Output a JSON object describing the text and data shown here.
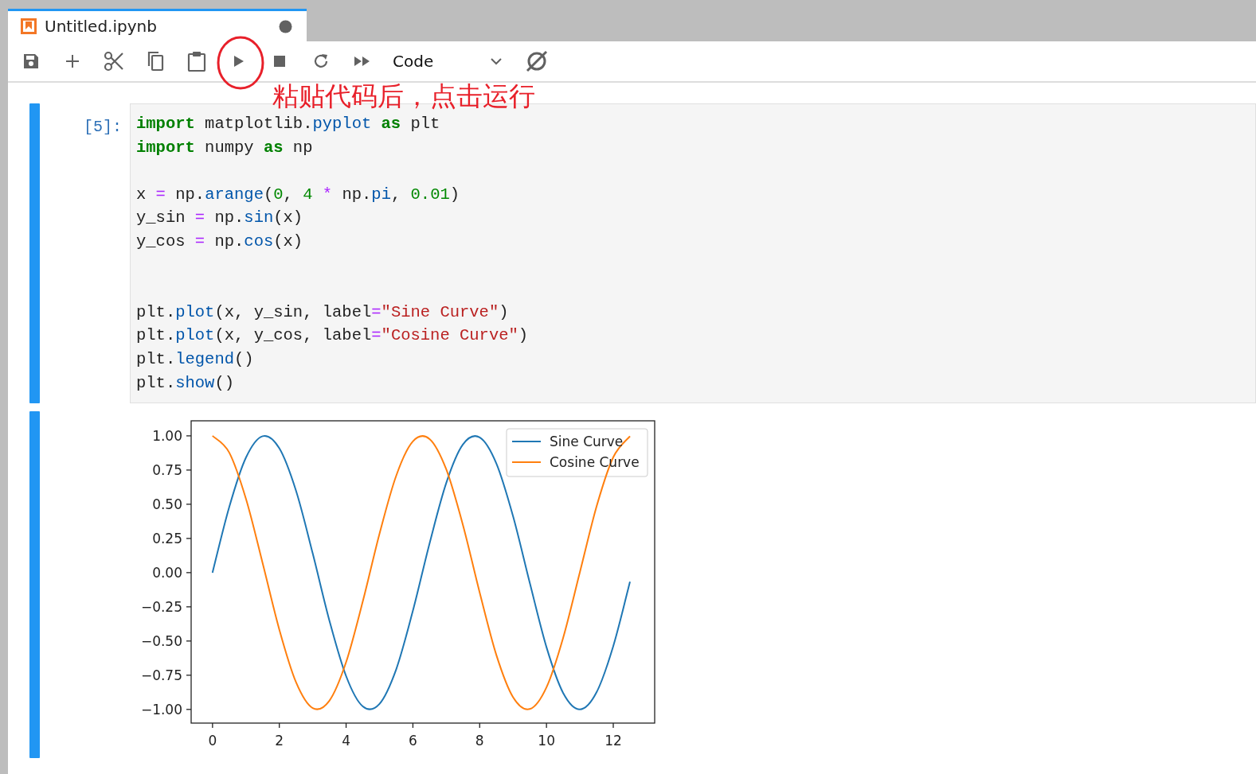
{
  "tab": {
    "title": "Untitled.ipynb"
  },
  "toolbar": {
    "cell_type": "Code"
  },
  "annotation": {
    "text": "粘贴代码后，点击运行"
  },
  "cell": {
    "prompt": "[5]:",
    "lines": [
      {
        "kind": "code",
        "tokens": [
          {
            "kind": "kw",
            "text": "import"
          },
          {
            "kind": "plain",
            "text": " matplotlib."
          },
          {
            "kind": "attr",
            "text": "pyplot"
          },
          {
            "kind": "kw",
            "text": " as"
          },
          {
            "kind": "plain",
            "text": " plt"
          }
        ]
      },
      {
        "kind": "code",
        "tokens": [
          {
            "kind": "kw",
            "text": "import"
          },
          {
            "kind": "plain",
            "text": " numpy "
          },
          {
            "kind": "kw",
            "text": "as"
          },
          {
            "kind": "plain",
            "text": " np"
          }
        ]
      },
      {
        "kind": "blank"
      },
      {
        "kind": "code",
        "tokens": [
          {
            "kind": "plain",
            "text": "x "
          },
          {
            "kind": "op",
            "text": "="
          },
          {
            "kind": "plain",
            "text": " np."
          },
          {
            "kind": "attr",
            "text": "arange"
          },
          {
            "kind": "plain",
            "text": "("
          },
          {
            "kind": "num",
            "text": "0"
          },
          {
            "kind": "plain",
            "text": ", "
          },
          {
            "kind": "num",
            "text": "4"
          },
          {
            "kind": "op",
            "text": " *"
          },
          {
            "kind": "plain",
            "text": " np."
          },
          {
            "kind": "attr",
            "text": "pi"
          },
          {
            "kind": "plain",
            "text": ", "
          },
          {
            "kind": "num",
            "text": "0.01"
          },
          {
            "kind": "plain",
            "text": ")"
          }
        ]
      },
      {
        "kind": "code",
        "tokens": [
          {
            "kind": "plain",
            "text": "y_sin "
          },
          {
            "kind": "op",
            "text": "="
          },
          {
            "kind": "plain",
            "text": " np."
          },
          {
            "kind": "attr",
            "text": "sin"
          },
          {
            "kind": "plain",
            "text": "(x)"
          }
        ]
      },
      {
        "kind": "code",
        "tokens": [
          {
            "kind": "plain",
            "text": "y_cos "
          },
          {
            "kind": "op",
            "text": "="
          },
          {
            "kind": "plain",
            "text": " np."
          },
          {
            "kind": "attr",
            "text": "cos"
          },
          {
            "kind": "plain",
            "text": "(x)"
          }
        ]
      },
      {
        "kind": "blank"
      },
      {
        "kind": "blank"
      },
      {
        "kind": "code",
        "tokens": [
          {
            "kind": "plain",
            "text": "plt."
          },
          {
            "kind": "attr",
            "text": "plot"
          },
          {
            "kind": "plain",
            "text": "(x, y_sin, label"
          },
          {
            "kind": "op",
            "text": "="
          },
          {
            "kind": "str",
            "text": "\"Sine Curve\""
          },
          {
            "kind": "plain",
            "text": ")"
          }
        ]
      },
      {
        "kind": "code",
        "tokens": [
          {
            "kind": "plain",
            "text": "plt."
          },
          {
            "kind": "attr",
            "text": "plot"
          },
          {
            "kind": "plain",
            "text": "(x, y_cos, label"
          },
          {
            "kind": "op",
            "text": "="
          },
          {
            "kind": "str",
            "text": "\"Cosine Curve\""
          },
          {
            "kind": "plain",
            "text": ")"
          }
        ]
      },
      {
        "kind": "code",
        "tokens": [
          {
            "kind": "plain",
            "text": "plt."
          },
          {
            "kind": "attr",
            "text": "legend"
          },
          {
            "kind": "plain",
            "text": "()"
          }
        ]
      },
      {
        "kind": "code",
        "tokens": [
          {
            "kind": "plain",
            "text": "plt."
          },
          {
            "kind": "attr",
            "text": "show"
          },
          {
            "kind": "plain",
            "text": "()"
          }
        ]
      }
    ]
  },
  "output": {
    "chart_data": {
      "type": "line",
      "x": [
        0,
        0.5,
        1,
        1.5,
        2,
        2.5,
        3,
        3.5,
        4,
        4.5,
        5,
        5.5,
        6,
        6.5,
        7,
        7.5,
        8,
        8.5,
        9,
        9.5,
        10,
        10.5,
        11,
        11.5,
        12,
        12.5
      ],
      "series": [
        {
          "name": "Sine Curve",
          "color": "#1f77b4",
          "values": [
            0,
            0.479,
            0.841,
            0.997,
            0.909,
            0.598,
            0.141,
            -0.351,
            -0.757,
            -0.978,
            -0.959,
            -0.706,
            -0.279,
            0.215,
            0.657,
            0.938,
            0.989,
            0.798,
            0.412,
            -0.075,
            -0.544,
            -0.88,
            -1.0,
            -0.875,
            -0.537,
            -0.066
          ]
        },
        {
          "name": "Cosine Curve",
          "color": "#ff7f0e",
          "values": [
            1,
            0.878,
            0.54,
            0.071,
            -0.416,
            -0.801,
            -0.99,
            -0.936,
            -0.654,
            -0.211,
            0.284,
            0.709,
            0.96,
            0.977,
            0.754,
            0.347,
            -0.146,
            -0.602,
            -0.911,
            -0.997,
            -0.839,
            -0.476,
            0.004,
            0.483,
            0.844,
            0.998
          ]
        }
      ],
      "legend": true,
      "xlim": [
        -0.64,
        13.24
      ],
      "ylim": [
        -1.1,
        1.11
      ],
      "xticks": [
        0,
        2,
        4,
        6,
        8,
        10,
        12
      ],
      "yticks": [
        {
          "value": 1,
          "label": "1.00"
        },
        {
          "value": 0.75,
          "label": "0.75"
        },
        {
          "value": 0.5,
          "label": "0.50"
        },
        {
          "value": 0.25,
          "label": "0.25"
        },
        {
          "value": 0,
          "label": "0.00"
        },
        {
          "value": -0.25,
          "label": "−0.25"
        },
        {
          "value": -0.5,
          "label": "−0.50"
        },
        {
          "value": -0.75,
          "label": "−0.75"
        },
        {
          "value": -1,
          "label": "−1.00"
        }
      ]
    }
  }
}
